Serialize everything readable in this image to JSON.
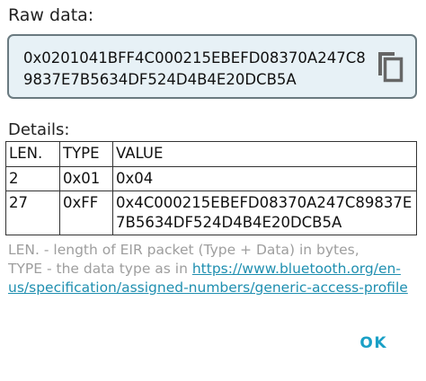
{
  "raw_section": {
    "label": "Raw data:",
    "value": "0x0201041BFF4C000215EBEFD08370A247C89837E7B5634DF524D4B4E20DCB5A",
    "copy_icon": "copy-icon"
  },
  "details_section": {
    "label": "Details:",
    "headers": [
      "LEN.",
      "TYPE",
      "VALUE"
    ],
    "rows": [
      {
        "len": "2",
        "type": "0x01",
        "value": "0x04"
      },
      {
        "len": "27",
        "type": "0xFF",
        "value": "0x4C000215EBEFD08370A247C89837E7B5634DF524D4B4E20DCB5A"
      }
    ]
  },
  "footnote": {
    "line1": "LEN. - length of EIR packet (Type + Data) in bytes,",
    "line2_prefix": "TYPE - the data type as in ",
    "link": "https://www.bluetooth.org/en-us/specification/assigned-numbers/generic-access-profile"
  },
  "actions": {
    "ok_label": "OK"
  },
  "colors": {
    "accent": "#1aa0c6",
    "raw_box_bg": "#e7f1f6",
    "hint_text": "#9e9e9e"
  }
}
